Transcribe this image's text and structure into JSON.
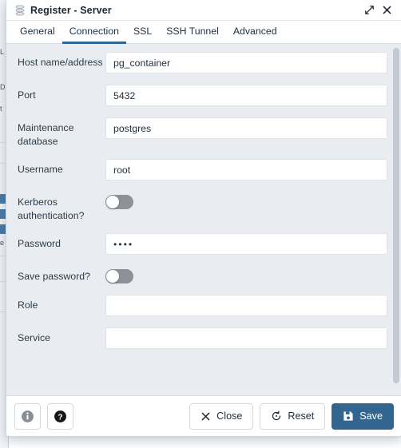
{
  "background_app": {
    "name": "pgadmin-browser-tree",
    "visible_fragment_labels": [
      "L",
      "D",
      "t",
      "e"
    ]
  },
  "dialog": {
    "title": "Register - Server",
    "title_icon": "server-database-icon",
    "titlebar_buttons": [
      {
        "name": "maximize-button",
        "icon": "expand-diagonal-icon",
        "label": ""
      },
      {
        "name": "close-button",
        "icon": "close-x-icon",
        "label": "✕"
      }
    ],
    "tabs": [
      {
        "label": "General",
        "active": false
      },
      {
        "label": "Connection",
        "active": true
      },
      {
        "label": "SSL",
        "active": false
      },
      {
        "label": "SSH Tunnel",
        "active": false
      },
      {
        "label": "Advanced",
        "active": false
      }
    ],
    "active_tab_underline_color": "#326690",
    "fields": [
      {
        "name": "host-name-address",
        "label": "Host name/address",
        "type": "text",
        "value": "pg_container",
        "placeholder": ""
      },
      {
        "name": "port",
        "label": "Port",
        "type": "text",
        "value": "5432",
        "placeholder": ""
      },
      {
        "name": "maintenance-database",
        "label": "Maintenance database",
        "type": "text",
        "value": "postgres",
        "placeholder": ""
      },
      {
        "name": "username",
        "label": "Username",
        "type": "text",
        "value": "root",
        "placeholder": ""
      },
      {
        "name": "kerberos-authentication",
        "label": "Kerberos authentication?",
        "type": "toggle",
        "value": "off",
        "placeholder": ""
      },
      {
        "name": "password",
        "label": "Password",
        "type": "password",
        "value": "••••",
        "placeholder": ""
      },
      {
        "name": "save-password",
        "label": "Save password?",
        "type": "toggle",
        "value": "off",
        "placeholder": ""
      },
      {
        "name": "role",
        "label": "Role",
        "type": "text",
        "value": "",
        "placeholder": ""
      },
      {
        "name": "service",
        "label": "Service",
        "type": "text",
        "value": "",
        "placeholder": ""
      }
    ],
    "footer": {
      "info_button": {
        "name": "info-button",
        "icon": "info-circle-icon",
        "label": ""
      },
      "help_button": {
        "name": "help-button",
        "icon": "question-circle-icon",
        "label": ""
      },
      "close_button": {
        "name": "close-button",
        "icon": "close-x-icon",
        "label": "Close"
      },
      "reset_button": {
        "name": "reset-button",
        "icon": "reset-circular-arrow-icon",
        "label": "Reset"
      },
      "save_button": {
        "name": "save-button",
        "icon": "floppy-disk-icon",
        "label": "Save"
      }
    },
    "colors": {
      "accent": "#326690",
      "form_background": "#e9edf2",
      "panel_background": "#ffffff",
      "toggle_off": "#8d9299",
      "scrollbar": "#c3cad3"
    }
  }
}
